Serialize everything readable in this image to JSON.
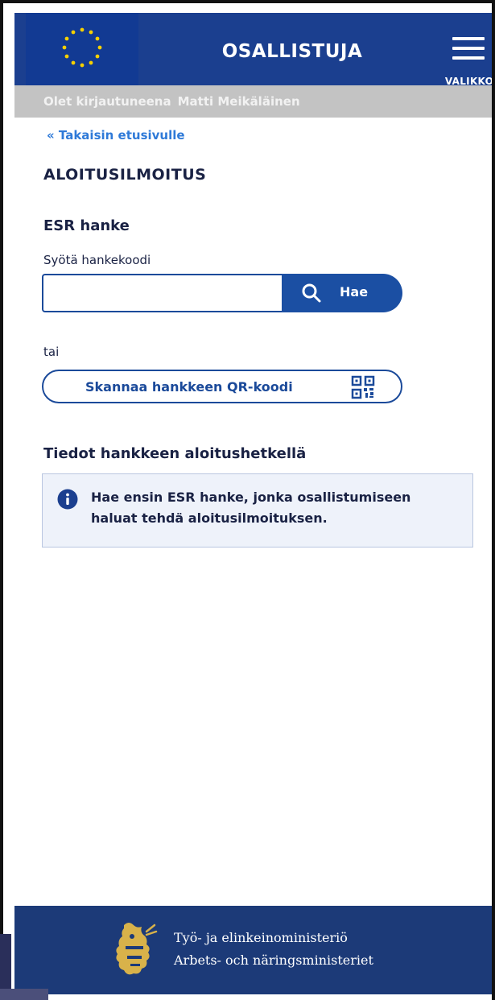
{
  "header": {
    "title": "OSALLISTUJA",
    "menu_label": "VALIKKO",
    "flag_icon": "eu-flag-icon",
    "menu_icon": "hamburger-menu-icon",
    "brand_color": "#1b3f8f"
  },
  "login_bar": {
    "prefix": "Olet kirjautuneena",
    "user_name": "Matti Meikäläinen"
  },
  "back_link": "« Takaisin etusivulle",
  "page_title": "ALOITUSILMOITUS",
  "search_section": {
    "title": "ESR hanke",
    "field_label": "Syötä hankekoodi",
    "input_value": "",
    "search_button_label": "Hae",
    "search_icon": "search-icon"
  },
  "or_text": "tai",
  "qr_button": {
    "label": "Skannaa hankkeen QR-koodi",
    "icon": "qr-code-icon"
  },
  "info_section": {
    "title": "Tiedot hankkeen aloitushetkellä",
    "message": "Hae ensin ESR hanke, jonka osallistumiseen haluat tehdä aloitusilmoituksen.",
    "icon": "info-icon"
  },
  "footer": {
    "ministry_fi": "Työ- ja elinkeinoministeriö",
    "ministry_sv": "Arbets- och näringsministeriet",
    "logo_icon": "ministry-lion-logo"
  }
}
